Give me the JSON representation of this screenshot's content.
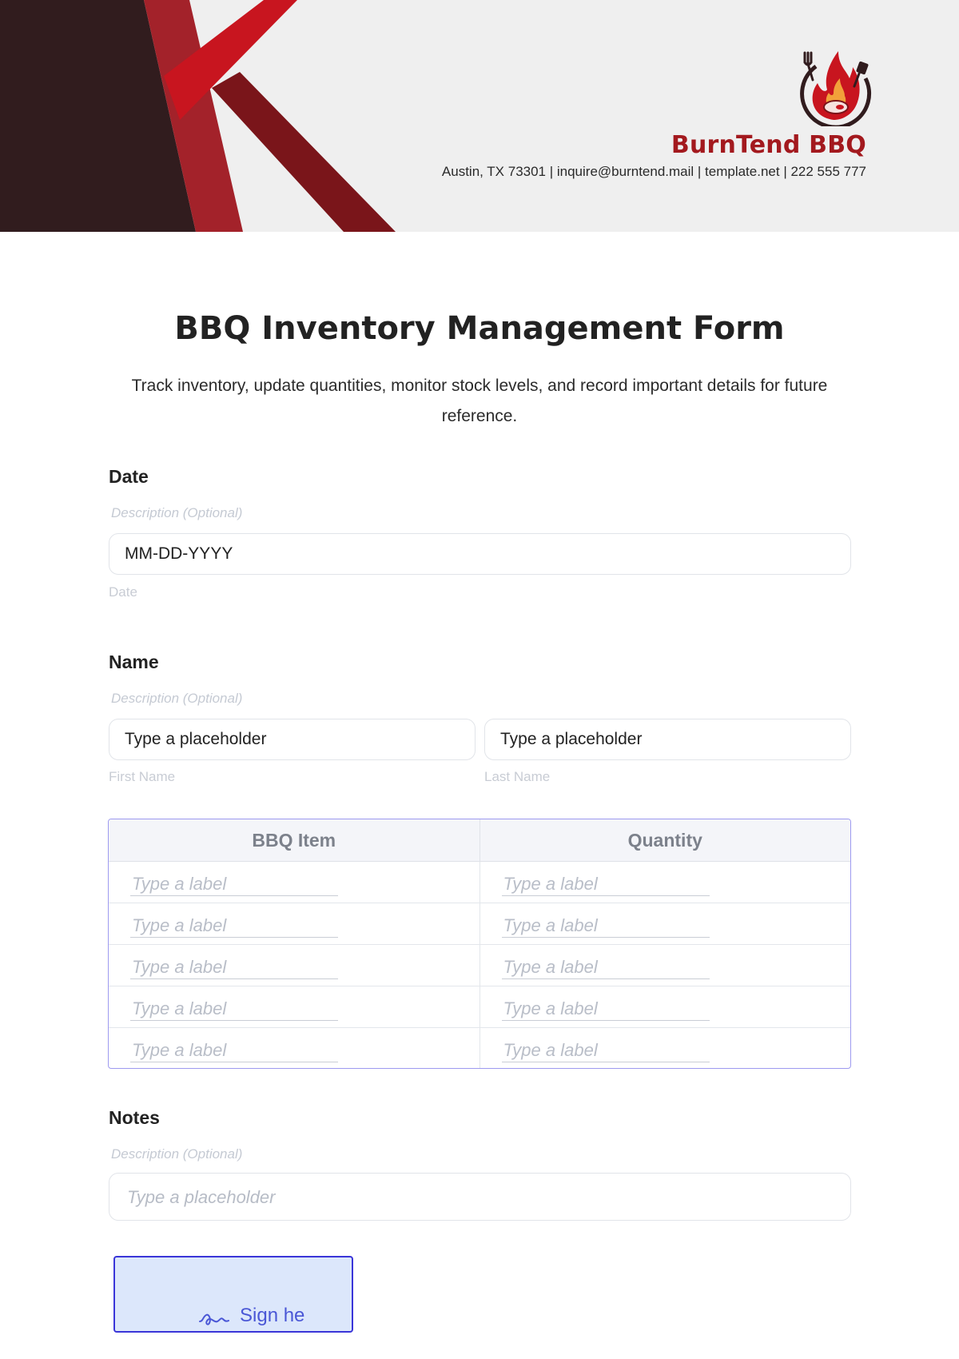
{
  "brand": {
    "name": "BurnTend BBQ",
    "contact": "Austin, TX 73301 | inquire@burntend.mail | template.net | 222 555 777",
    "logo_icon": "flame-steak-logo-icon",
    "colors": {
      "primary": "#a3191e",
      "dark": "#311c1e",
      "accent": "#c8151f"
    }
  },
  "form": {
    "title": "BBQ Inventory Management Form",
    "subtitle": "Track inventory, update quantities, monitor stock levels, and record important details for future reference."
  },
  "date_field": {
    "label": "Date",
    "description": "Description (Optional)",
    "value": "MM-DD-YYYY",
    "sub_label": "Date"
  },
  "name_field": {
    "label": "Name",
    "description": "Description (Optional)",
    "first_placeholder": "Type a placeholder",
    "last_placeholder": "Type a placeholder",
    "first_sub_label": "First Name",
    "last_sub_label": "Last Name"
  },
  "inventory_table": {
    "headers": [
      "BBQ Item",
      "Quantity"
    ],
    "rows": [
      [
        "Type a label",
        "Type a label"
      ],
      [
        "Type a label",
        "Type a label"
      ],
      [
        "Type a label",
        "Type a label"
      ],
      [
        "Type a label",
        "Type a label"
      ],
      [
        "Type a label",
        "Type a label"
      ]
    ]
  },
  "notes_field": {
    "label": "Notes",
    "description": "Description (Optional)",
    "placeholder": "Type a placeholder"
  },
  "signature": {
    "label": "Sign he",
    "icon": "signature-icon"
  }
}
